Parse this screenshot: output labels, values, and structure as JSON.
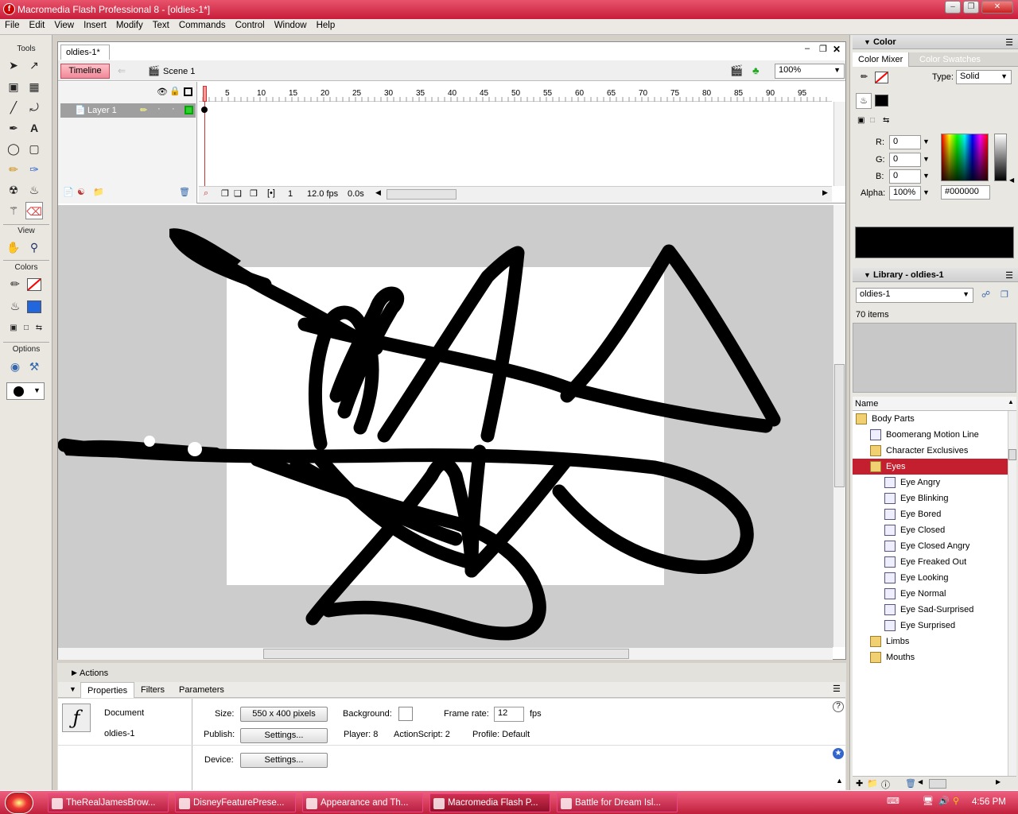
{
  "window": {
    "title": "Macromedia Flash Professional 8 - [oldies-1*]"
  },
  "menu": [
    "File",
    "Edit",
    "View",
    "Insert",
    "Modify",
    "Text",
    "Commands",
    "Control",
    "Window",
    "Help"
  ],
  "tools": {
    "tools_label": "Tools",
    "view_label": "View",
    "colors_label": "Colors",
    "options_label": "Options"
  },
  "document": {
    "tab": "oldies-1*",
    "timeline_button": "Timeline",
    "scene": "Scene 1",
    "zoom": "100%",
    "layer_name": "Layer 1",
    "ruler": [
      "1",
      "5",
      "10",
      "15",
      "20",
      "25",
      "30",
      "35",
      "40",
      "45",
      "50",
      "55",
      "60",
      "65",
      "70",
      "75",
      "80",
      "85",
      "90",
      "95"
    ],
    "frame": "1",
    "fps": "12.0 fps",
    "time": "0.0s"
  },
  "panels": {
    "actions": "Actions",
    "tabs": [
      "Properties",
      "Filters",
      "Parameters"
    ],
    "doc_label": "Document",
    "doc_name": "oldies-1",
    "size_label": "Size:",
    "size_value": "550 x 400 pixels",
    "background_label": "Background:",
    "framerate_label": "Frame rate:",
    "framerate_value": "12",
    "fps_unit": "fps",
    "publish_label": "Publish:",
    "settings": "Settings...",
    "player": "Player: 8",
    "actionscript": "ActionScript:  2",
    "profile": "Profile:  Default",
    "device_label": "Device:"
  },
  "color": {
    "header": "Color",
    "tab_mixer": "Color Mixer",
    "tab_swatches": "Color Swatches",
    "type_label": "Type:",
    "type_value": "Solid",
    "r_label": "R:",
    "r": "0",
    "g_label": "G:",
    "g": "0",
    "b_label": "B:",
    "b": "0",
    "alpha_label": "Alpha:",
    "alpha": "100%",
    "hex": "#000000",
    "fill_color": "#000000"
  },
  "library": {
    "header": "Library - oldies-1",
    "dropdown": "oldies-1",
    "count": "70 items",
    "col_name": "Name",
    "items": [
      {
        "label": "Body Parts",
        "kind": "folder-open",
        "level": 0
      },
      {
        "label": "Boomerang Motion Line",
        "kind": "symbol",
        "level": 1
      },
      {
        "label": "Character Exclusives",
        "kind": "folder",
        "level": 1
      },
      {
        "label": "Eyes",
        "kind": "folder-open",
        "level": 1,
        "selected": true
      },
      {
        "label": "Eye Angry",
        "kind": "symbol",
        "level": 2
      },
      {
        "label": "Eye Blinking",
        "kind": "symbol",
        "level": 2
      },
      {
        "label": "Eye Bored",
        "kind": "symbol",
        "level": 2
      },
      {
        "label": "Eye Closed",
        "kind": "symbol",
        "level": 2
      },
      {
        "label": "Eye Closed Angry",
        "kind": "symbol",
        "level": 2
      },
      {
        "label": "Eye Freaked Out",
        "kind": "symbol",
        "level": 2
      },
      {
        "label": "Eye Looking",
        "kind": "symbol",
        "level": 2
      },
      {
        "label": "Eye Normal",
        "kind": "symbol",
        "level": 2
      },
      {
        "label": "Eye Sad-Surprised",
        "kind": "symbol",
        "level": 2
      },
      {
        "label": "Eye Surprised",
        "kind": "symbol",
        "level": 2
      },
      {
        "label": "Limbs",
        "kind": "folder",
        "level": 1
      },
      {
        "label": "Mouths",
        "kind": "folder",
        "level": 1
      }
    ]
  },
  "taskbar": {
    "tasks": [
      "TheRealJamesBrow...",
      "DisneyFeaturePrese...",
      "Appearance and Th...",
      "Macromedia Flash P...",
      "Battle for Dream Isl..."
    ],
    "active": 3,
    "clock": "4:56 PM"
  }
}
